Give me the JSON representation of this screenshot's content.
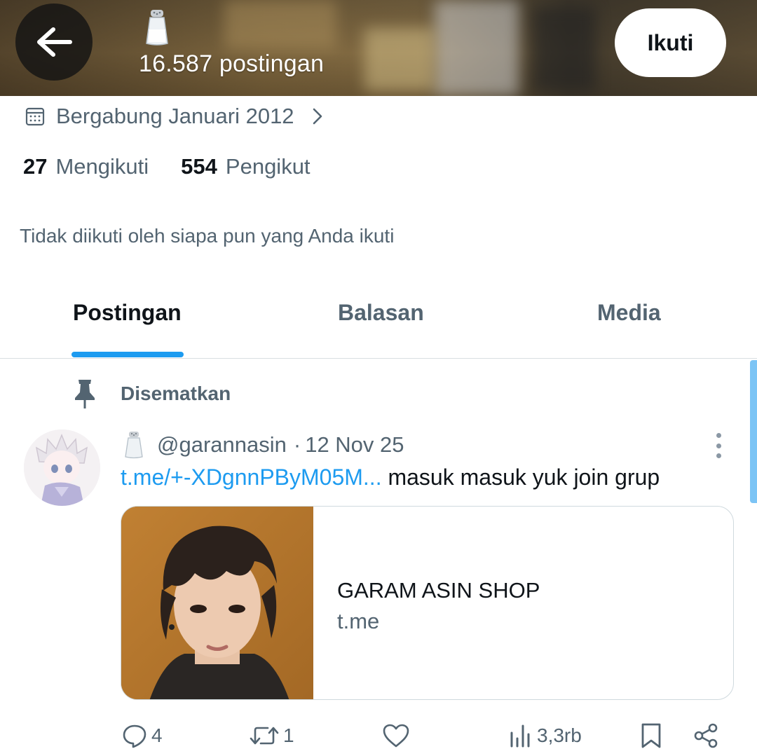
{
  "header": {
    "post_count": "16.587 postingan",
    "follow_label": "Ikuti"
  },
  "profile": {
    "joined": "Bergabung Januari 2012",
    "following_count": "27",
    "following_label": "Mengikuti",
    "followers_count": "554",
    "followers_label": "Pengikut",
    "not_followed_text": "Tidak diikuti oleh siapa pun yang Anda ikuti"
  },
  "tabs": [
    {
      "label": "Postingan",
      "active": true
    },
    {
      "label": "Balasan",
      "active": false
    },
    {
      "label": "Media",
      "active": false
    }
  ],
  "post": {
    "pinned_label": "Disematkan",
    "handle": "@garannasin",
    "date": "12 Nov 25",
    "link_text": "t.me/+-XDgnnPByM05M...",
    "body_text": "masuk masuk yuk join grup",
    "card": {
      "title": "GARAM ASIN SHOP",
      "domain": "t.me"
    },
    "actions": {
      "replies": "4",
      "reposts": "1",
      "views": "3,3rb"
    }
  },
  "icons": {
    "back": "arrow-left-icon",
    "emoji": "salt-shaker-icon",
    "calendar": "calendar-icon",
    "pin": "pin-icon",
    "more": "more-vertical-icon",
    "reply": "reply-icon",
    "repost": "repost-icon",
    "like": "heart-icon",
    "views": "views-icon",
    "bookmark": "bookmark-icon",
    "share": "share-icon"
  },
  "colors": {
    "accent": "#1d9bf0",
    "secondary_text": "#536471",
    "primary_text": "#0f1419"
  }
}
